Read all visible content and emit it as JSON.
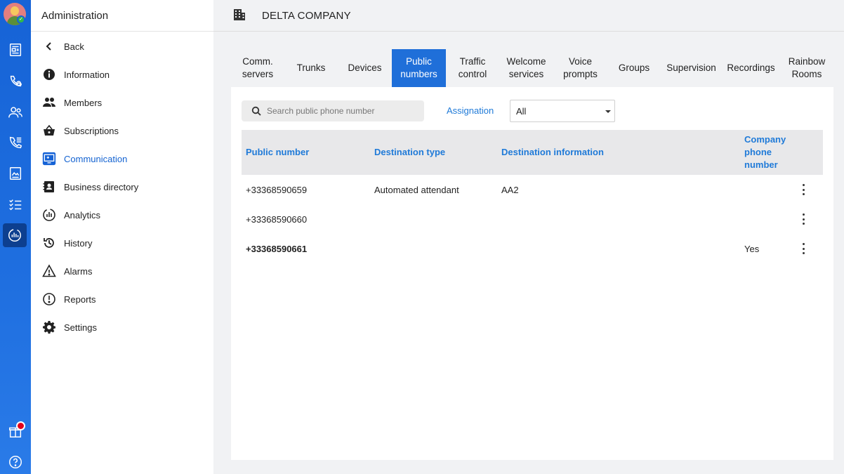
{
  "rail": {
    "items": [
      {
        "name": "news-icon"
      },
      {
        "name": "phone-settings-icon"
      },
      {
        "name": "contacts-icon"
      },
      {
        "name": "call-log-icon"
      },
      {
        "name": "document-icon"
      },
      {
        "name": "checklist-icon"
      },
      {
        "name": "admin-analytics-icon",
        "active": true
      }
    ],
    "bottom": [
      {
        "name": "gift-icon",
        "badge": true
      },
      {
        "name": "help-icon"
      }
    ]
  },
  "side": {
    "title": "Administration",
    "items": [
      {
        "label": "Back",
        "icon": "chevron-left-icon"
      },
      {
        "label": "Information",
        "icon": "info-icon"
      },
      {
        "label": "Members",
        "icon": "members-icon"
      },
      {
        "label": "Subscriptions",
        "icon": "basket-icon"
      },
      {
        "label": "Communication",
        "icon": "communication-icon",
        "active": true
      },
      {
        "label": "Business directory",
        "icon": "directory-icon"
      },
      {
        "label": "Analytics",
        "icon": "analytics-icon"
      },
      {
        "label": "History",
        "icon": "history-icon"
      },
      {
        "label": "Alarms",
        "icon": "warning-icon"
      },
      {
        "label": "Reports",
        "icon": "report-icon"
      },
      {
        "label": "Settings",
        "icon": "gear-icon"
      }
    ]
  },
  "topbar": {
    "company": "DELTA COMPANY",
    "icon": "building-icon"
  },
  "tabs": [
    {
      "label": "Comm.\nservers"
    },
    {
      "label": "Trunks"
    },
    {
      "label": "Devices"
    },
    {
      "label": "Public\nnumbers",
      "active": true
    },
    {
      "label": "Traffic\ncontrol"
    },
    {
      "label": "Welcome\nservices"
    },
    {
      "label": "Voice\nprompts"
    },
    {
      "label": "Groups"
    },
    {
      "label": "Supervision"
    },
    {
      "label": "Recordings"
    },
    {
      "label": "Rainbow\nRooms"
    }
  ],
  "search": {
    "placeholder": "Search public phone number",
    "value": ""
  },
  "filter": {
    "label": "Assignation",
    "selected": "All"
  },
  "table": {
    "columns": [
      "Public number",
      "Destination type",
      "Destination information",
      "Company phone number"
    ],
    "rows": [
      {
        "number": "+33368590659",
        "type": "Automated attendant",
        "info": "AA2",
        "company": "",
        "bold": false
      },
      {
        "number": "+33368590660",
        "type": "",
        "info": "",
        "company": "",
        "bold": false
      },
      {
        "number": "+33368590661",
        "type": "",
        "info": "",
        "company": "Yes",
        "bold": true
      }
    ]
  },
  "colors": {
    "accent": "#1f6fd9",
    "link": "#1f7ad8",
    "rail": "#1663d6",
    "active_rail": "#0d3f8f",
    "badge": "#e3001b"
  }
}
